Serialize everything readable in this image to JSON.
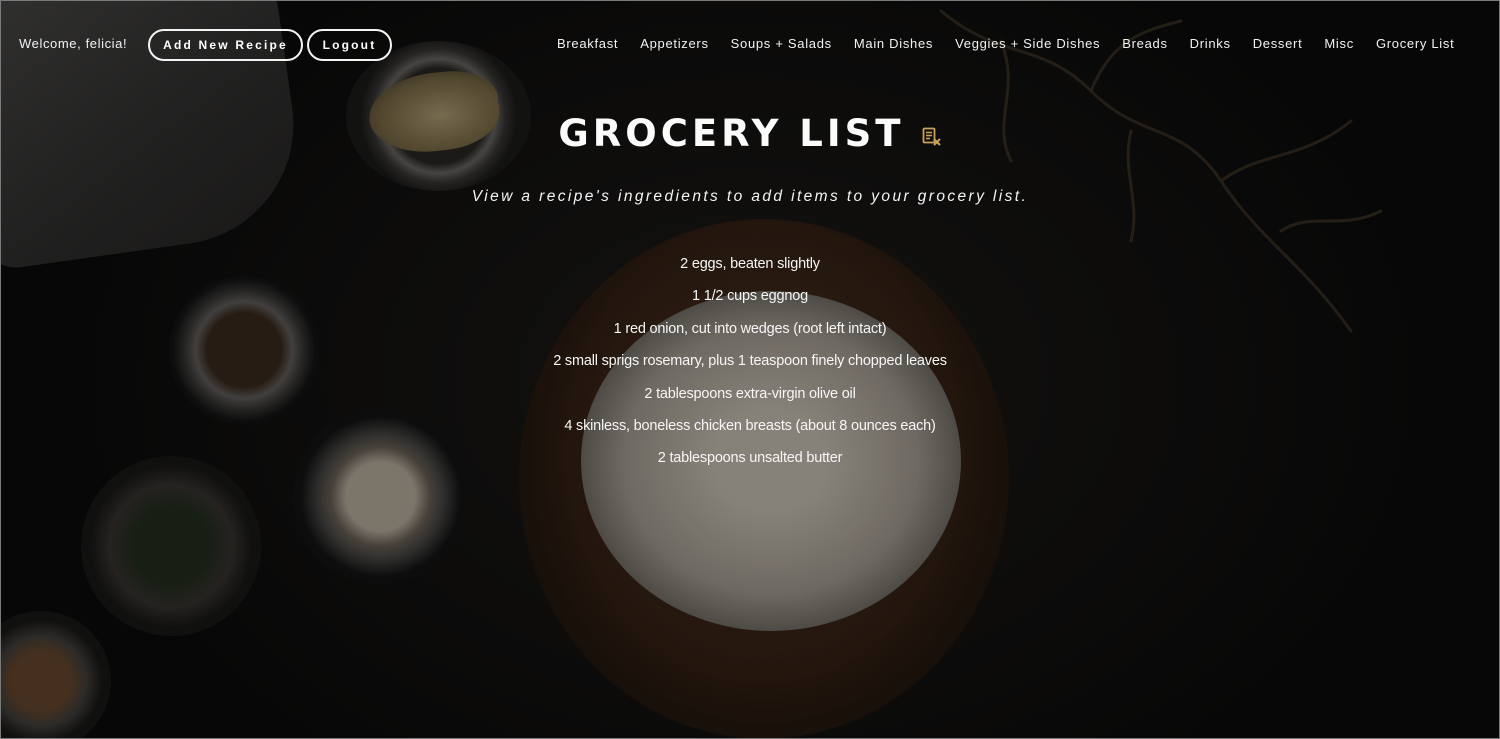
{
  "header": {
    "welcome_text": "Welcome, felicia!",
    "add_recipe_label": "Add New Recipe",
    "logout_label": "Logout",
    "nav_items": [
      {
        "label": "Breakfast"
      },
      {
        "label": "Appetizers"
      },
      {
        "label": "Soups + Salads"
      },
      {
        "label": "Main Dishes"
      },
      {
        "label": "Veggies + Side Dishes"
      },
      {
        "label": "Breads"
      },
      {
        "label": "Drinks"
      },
      {
        "label": "Dessert"
      },
      {
        "label": "Misc"
      },
      {
        "label": "Grocery List"
      }
    ]
  },
  "main": {
    "title": "GROCERY LIST",
    "title_icon": "clear-list-icon",
    "subtitle": "View a recipe's ingredients to add items to your grocery list.",
    "items": [
      {
        "text": "2 eggs, beaten slightly"
      },
      {
        "text": "1 1/2 cups eggnog"
      },
      {
        "text": "1 red onion, cut into wedges (root left intact)"
      },
      {
        "text": "2 small sprigs rosemary, plus 1 teaspoon finely chopped leaves"
      },
      {
        "text": "2 tablespoons extra-virgin olive oil"
      },
      {
        "text": "4 skinless, boneless chicken breasts (about 8 ounces each)"
      },
      {
        "text": "2 tablespoons unsalted butter"
      }
    ]
  },
  "colors": {
    "background": "#141313",
    "text": "#ffffff",
    "icon_accent": "#c9a15a"
  }
}
